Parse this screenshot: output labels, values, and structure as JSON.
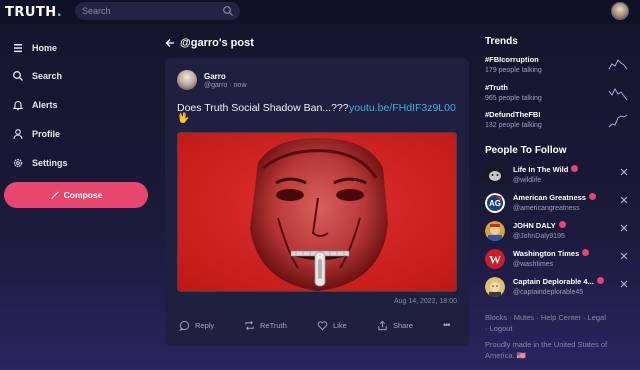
{
  "topbar": {
    "logo": "TRUTH",
    "logo_dot": ".",
    "search_placeholder": "Search"
  },
  "sidebar": {
    "items": [
      {
        "label": "Home",
        "icon": "home-icon"
      },
      {
        "label": "Search",
        "icon": "search-icon"
      },
      {
        "label": "Alerts",
        "icon": "bell-icon"
      },
      {
        "label": "Profile",
        "icon": "user-icon"
      },
      {
        "label": "Settings",
        "icon": "gear-icon"
      }
    ],
    "compose_label": "Compose"
  },
  "post": {
    "header_title": "@garro's post",
    "author": "Garro",
    "handle": "@garro · now",
    "text": "Does Truth Social Shadow Ban...???",
    "link": "youtu.be/FHdIF3z9L00",
    "emoji": "🖖",
    "timestamp": "Aug 14, 2022, 18:00",
    "actions": {
      "reply": "Reply",
      "retruth": "ReTruth",
      "like": "Like",
      "share": "Share"
    }
  },
  "trends": {
    "title": "Trends",
    "items": [
      {
        "tag": "#FBIcorruption",
        "count": "179 people talking"
      },
      {
        "tag": "#Truth",
        "count": "965 people talking"
      },
      {
        "tag": "#DefundTheFBI",
        "count": "132 people talking"
      }
    ]
  },
  "follow": {
    "title": "People To Follow",
    "items": [
      {
        "name": "Life In The Wild",
        "handle": "@wildlife"
      },
      {
        "name": "American Greatness",
        "handle": "@americangreatness"
      },
      {
        "name": "JOHN DALY",
        "handle": "@JohnDaly9195"
      },
      {
        "name": "Washington Times",
        "handle": "@washtimes"
      },
      {
        "name": "Captain Deplorable 4...",
        "handle": "@captaindeplorable45"
      }
    ]
  },
  "footer": {
    "links": "Blocks · Mutes · Help Center · Legal · Logout",
    "made_in": "Proudly made in the United States of America. 🇺🇸"
  },
  "colors": {
    "accent": "#e8456f",
    "link": "#36b7e0",
    "logo_dot": "#3fd2c7",
    "background": "#1a1a3a"
  }
}
